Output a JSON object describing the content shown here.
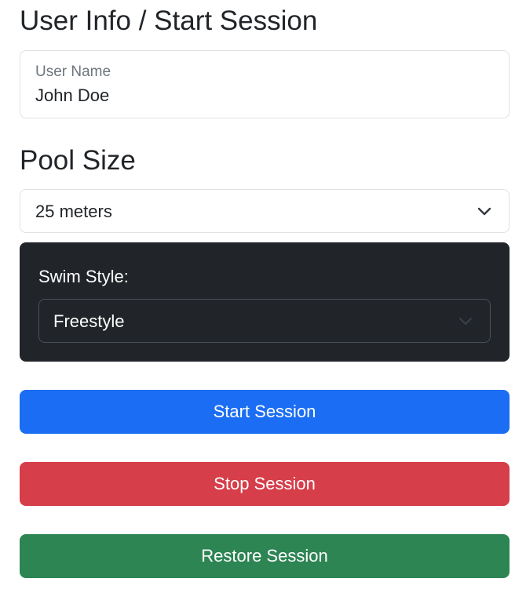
{
  "user_section": {
    "heading": "User Info / Start Session",
    "username_label": "User Name",
    "username_value": "John Doe"
  },
  "pool_section": {
    "heading": "Pool Size",
    "selected": "25 meters"
  },
  "style_section": {
    "label": "Swim Style:",
    "selected": "Freestyle"
  },
  "buttons": {
    "start": {
      "label": "Start Session",
      "color": "#1b6ef3"
    },
    "stop": {
      "label": "Stop Session",
      "color": "#d63e4a"
    },
    "restore": {
      "label": "Restore Session",
      "color": "#2e8554"
    }
  },
  "icons": {
    "pool_select": "chevron-down-icon",
    "style_select": "chevron-down-icon"
  }
}
